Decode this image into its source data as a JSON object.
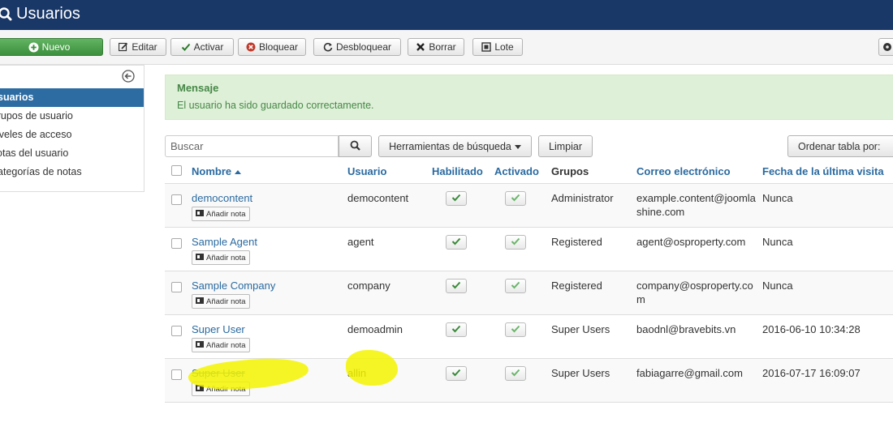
{
  "header": {
    "title": "Usuarios",
    "icon": "search-icon"
  },
  "toolbar": {
    "new_label": "Nuevo",
    "edit_label": "Editar",
    "activate_label": "Activar",
    "block_label": "Bloquear",
    "unblock_label": "Desbloquear",
    "delete_label": "Borrar",
    "batch_label": "Lote"
  },
  "sidebar": {
    "items": [
      {
        "label": "Usuarios"
      },
      {
        "label": "Grupos de usuario"
      },
      {
        "label": "Niveles de acceso"
      },
      {
        "label": "Notas del usuario"
      },
      {
        "label": "Categorías de notas"
      }
    ]
  },
  "message": {
    "heading": "Mensaje",
    "text": "El usuario ha sido guardado correctamente."
  },
  "filters": {
    "search_placeholder": "Buscar",
    "search_tools_label": "Herramientas de búsqueda",
    "clear_label": "Limpiar",
    "order_label": "Ordenar tabla por:"
  },
  "table": {
    "columns": {
      "name": "Nombre",
      "username": "Usuario",
      "enabled": "Habilitado",
      "activated": "Activado",
      "groups": "Grupos",
      "email": "Correo electrónico",
      "last_visit": "Fecha de la última visita"
    },
    "add_note_label": "Añadir nota",
    "rows": [
      {
        "name": "democontent",
        "username": "democontent",
        "group": "Administrator",
        "email": "example.content@joomlashine.com",
        "last_visit": "Nunca",
        "enabled": true,
        "activated": true
      },
      {
        "name": "Sample Agent",
        "username": "agent",
        "group": "Registered",
        "email": "agent@osproperty.com",
        "last_visit": "Nunca",
        "enabled": true,
        "activated": true
      },
      {
        "name": "Sample Company",
        "username": "company",
        "group": "Registered",
        "email": "company@osproperty.com",
        "last_visit": "Nunca",
        "enabled": true,
        "activated": true
      },
      {
        "name": "Super User",
        "username": "demoadmin",
        "group": "Super Users",
        "email": "baodnl@bravebits.vn",
        "last_visit": "2016-06-10 10:34:28",
        "enabled": true,
        "activated": true
      },
      {
        "name": "Super User",
        "username": "allin",
        "group": "Super Users",
        "email": "fabiagarre@gmail.com",
        "last_visit": "2016-07-17 16:09:07",
        "enabled": true,
        "activated": true
      }
    ]
  },
  "colors": {
    "header_bg": "#1a3867",
    "accent": "#2a6aa0",
    "success_bg": "#dff0d8",
    "success_text": "#468847",
    "highlight": "#f5f500"
  }
}
